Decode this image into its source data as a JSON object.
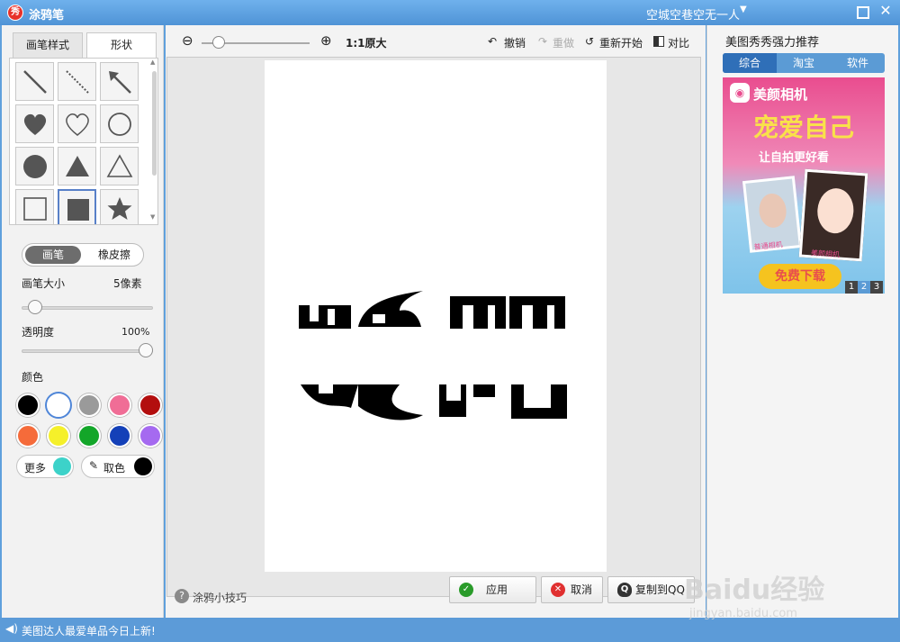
{
  "app": {
    "icon_text": "秀",
    "title": "涂鸦笔",
    "user": "空城空巷空无一人"
  },
  "left": {
    "tabs": [
      "画笔样式",
      "形状"
    ],
    "shapes": [
      "line",
      "dashed-line",
      "arrow",
      "heart-filled",
      "heart-outline",
      "circle-outline",
      "circle-filled",
      "triangle-filled",
      "triangle-outline",
      "square-outline",
      "square-filled",
      "star"
    ],
    "toggle": {
      "pen": "画笔",
      "eraser": "橡皮擦"
    },
    "brush_size": {
      "label": "画笔大小",
      "value": "5像素",
      "level": 0.05
    },
    "opacity": {
      "label": "透明度",
      "value": "100%",
      "level": 1.0
    },
    "color_label": "颜色",
    "colors": [
      "#000000",
      "#ffffff",
      "#9a9a9a",
      "#f06d96",
      "#b30e0e",
      "#f56b3a",
      "#f5f02a",
      "#13a629",
      "#1440b8",
      "#a56af0"
    ],
    "more": {
      "label": "更多",
      "color": "#3cd2c9"
    },
    "picker": {
      "label": "取色",
      "color": "#000000"
    }
  },
  "toolbar": {
    "zoom_label": "1:1原大",
    "undo": "撤销",
    "redo": "重做",
    "restart": "重新开始",
    "compare": "对比"
  },
  "bottom": {
    "tips": "涂鸦小技巧",
    "apply": "应用",
    "cancel": "取消",
    "copy_qq": "复制到QQ"
  },
  "right": {
    "title": "美图秀秀强力推荐",
    "tabs": [
      "综合",
      "淘宝",
      "软件"
    ],
    "ad": {
      "app_name": "美颜相机",
      "slogan": "宠爱自己",
      "sub": "让自拍更好看",
      "download": "免费下载",
      "pages": [
        "1",
        "2",
        "3"
      ],
      "photo_tag1": "普通相机",
      "photo_tag2": "美颜相机"
    }
  },
  "status": {
    "text": "美图达人最爱单品今日上新!"
  },
  "watermark": {
    "text": "Baidu经验",
    "url": "jingyan.baidu.com"
  }
}
